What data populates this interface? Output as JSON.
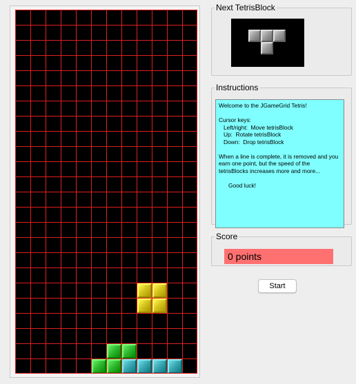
{
  "next_block": {
    "title": "Next TetrisBlock",
    "piece": "T",
    "color": "#9a9a9a"
  },
  "instructions": {
    "title": "Instructions",
    "lines": [
      "Welcome to the JGameGrid Tetris!",
      "",
      "Cursor keys:",
      "   Left/right:  Move tetrisBlock",
      "   Up:  Rotate tetrisBlock",
      "   Down:  Drop tetrisBlock",
      "",
      "When a  line  is complete, it is removed and you earn one point, but the speed of  the tetrisBlocks increases more and more...",
      "",
      "      Good luck!"
    ]
  },
  "score": {
    "title": "Score",
    "value": "0 points",
    "color": "#ff7070"
  },
  "start_button": {
    "label": "Start"
  },
  "board": {
    "columns": 12,
    "rows": 24,
    "background": "#000000",
    "grid_color": "#e02020",
    "blocks": [
      {
        "piece": "O",
        "color": "#d4c21c",
        "cells": [
          [
            8,
            18
          ],
          [
            9,
            18
          ],
          [
            8,
            19
          ],
          [
            9,
            19
          ]
        ]
      },
      {
        "piece": "green",
        "color": "#2fb82f",
        "cells": [
          [
            6,
            22
          ],
          [
            7,
            22
          ],
          [
            5,
            23
          ],
          [
            6,
            23
          ]
        ]
      },
      {
        "piece": "I",
        "color": "#3aa6b0",
        "cells": [
          [
            7,
            23
          ],
          [
            8,
            23
          ],
          [
            9,
            23
          ],
          [
            10,
            23
          ]
        ]
      }
    ]
  }
}
